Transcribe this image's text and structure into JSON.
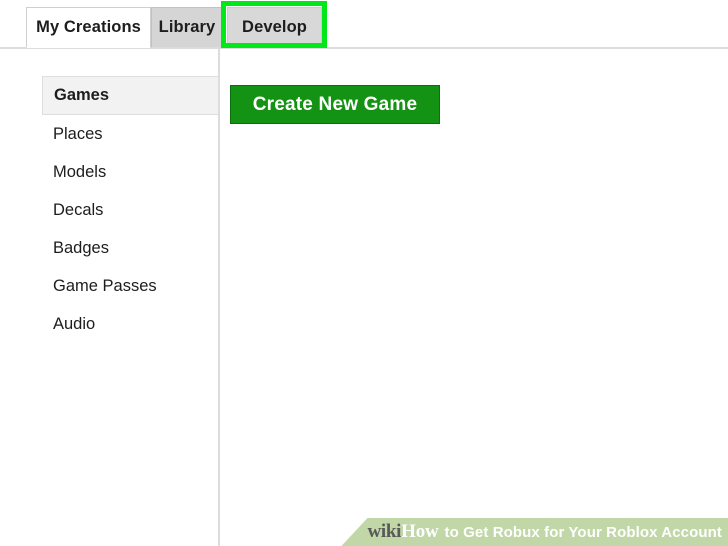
{
  "tabs": [
    {
      "label": "My Creations",
      "state": "active"
    },
    {
      "label": "Library",
      "state": "inactive"
    },
    {
      "label": "Develop",
      "state": "highlighted"
    }
  ],
  "sidebar": {
    "items": [
      {
        "label": "Games",
        "state": "active"
      },
      {
        "label": "Places",
        "state": "inactive"
      },
      {
        "label": "Models",
        "state": "inactive"
      },
      {
        "label": "Decals",
        "state": "inactive"
      },
      {
        "label": "Badges",
        "state": "inactive"
      },
      {
        "label": "Game Passes",
        "state": "inactive"
      },
      {
        "label": "Audio",
        "state": "inactive"
      }
    ]
  },
  "main": {
    "create_button_label": "Create New Game"
  },
  "watermark": {
    "brand_wiki": "wiki",
    "brand_how": "How",
    "title": "to Get Robux for Your Roblox Account"
  },
  "colors": {
    "highlight_green": "#00e818",
    "button_green": "#139213",
    "button_border_green": "#0b6f0b",
    "tab_inactive_gray": "#d5d5d5",
    "active_item_gray": "#f2f2f2",
    "rule_gray": "#dcdcdc",
    "watermark_green": "#bcd4a0",
    "text_dark": "#1d1d1d"
  }
}
